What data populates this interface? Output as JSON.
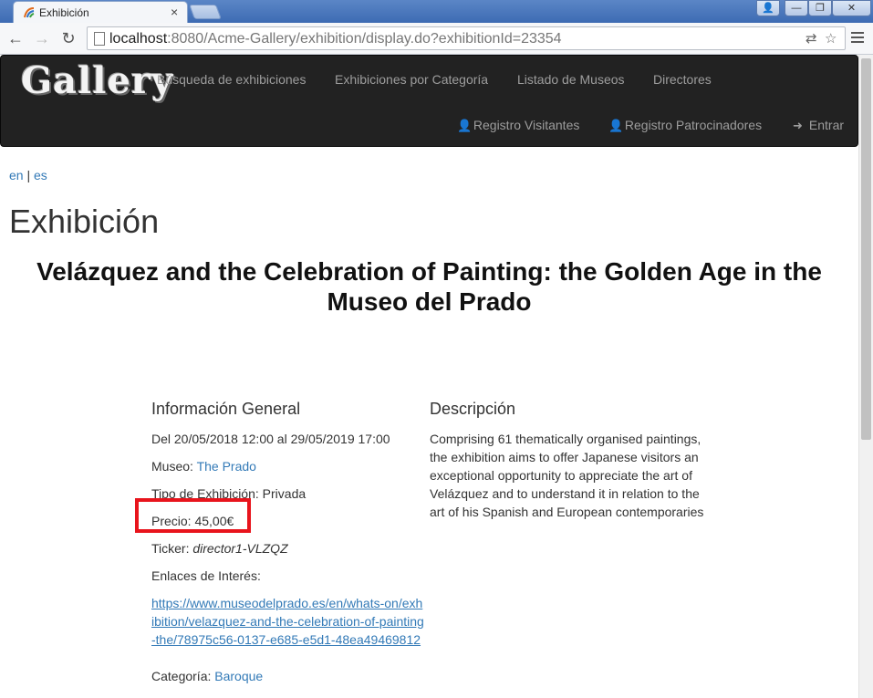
{
  "browser": {
    "tab_title": "Exhibición",
    "tab_close": "×",
    "url_host": "localhost",
    "url_rest": ":8080/Acme-Gallery/exhibition/display.do?exhibitionId=23354",
    "win_buttons": [
      "👤",
      "—",
      "❐",
      "✕"
    ]
  },
  "navbar": {
    "brand": "Gallery",
    "links": [
      "Búsqueda de exhibiciones",
      "Exhibiciones por Categoría",
      "Listado de Museos",
      "Directores"
    ],
    "right_links": [
      {
        "icon": "user-icon",
        "label": "Registro Visitantes"
      },
      {
        "icon": "user-icon",
        "label": "Registro Patrocinadores"
      },
      {
        "icon": "login-icon",
        "label": "Entrar"
      }
    ]
  },
  "lang": {
    "en": "en",
    "sep": "|",
    "es": "es"
  },
  "page": {
    "title": "Exhibición",
    "exhibition_title": "Velázquez and the Celebration of Painting: the Golden Age in the Museo del Prado"
  },
  "info": {
    "heading": "Información General",
    "dates": "Del 20/05/2018 12:00 al 29/05/2019 17:00",
    "museum_label": "Museo:",
    "museum_value": "The Prado",
    "type_label": "Tipo de Exhibición:",
    "type_value": "Privada",
    "price_label": "Precio:",
    "price_value": "45,00€",
    "ticker_label": "Ticker:",
    "ticker_value": "director1-VLZQZ",
    "links_label": "Enlaces de Interés:",
    "link_url": "https://www.museodelprado.es/en/whats-on/exhibition/velazquez-and-the-celebration-of-painting-the/78975c56-0137-e685-e5d1-48ea49469812",
    "category_label": "Categoría:",
    "category_value": "Baroque"
  },
  "description": {
    "heading": "Descripción",
    "text": "Comprising 61 thematically organised paintings, the exhibition aims to offer Japanese visitors an exceptional opportunity to appreciate the art of Velázquez and to understand it in relation to the art of his Spanish and European contemporaries"
  },
  "colors": {
    "highlight": "#e8141c",
    "link": "#337ab7",
    "navbar": "#222222"
  }
}
